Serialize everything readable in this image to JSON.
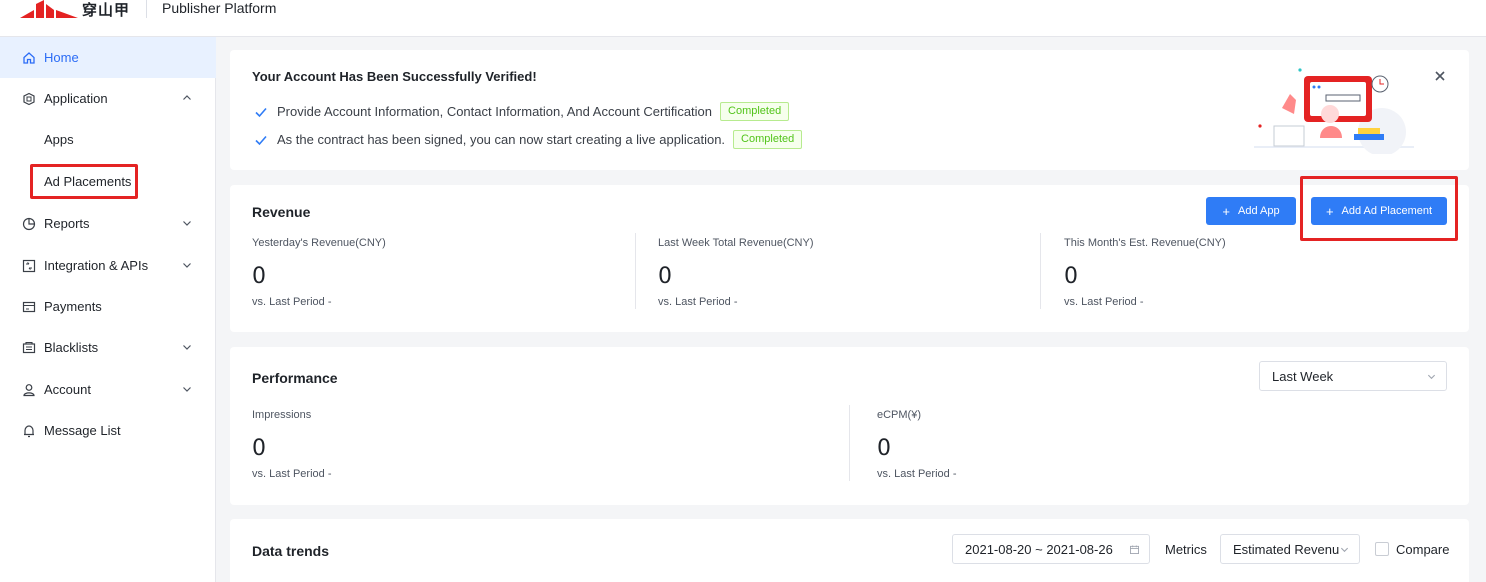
{
  "header": {
    "logo_text": "穿山甲",
    "platform_title": "Publisher Platform"
  },
  "sidebar": {
    "items": [
      {
        "label": "Home",
        "icon": "home-icon",
        "active": true
      },
      {
        "label": "Application",
        "icon": "application-icon",
        "expanded": true
      },
      {
        "label": "Apps",
        "sub": true
      },
      {
        "label": "Ad Placements",
        "sub": true
      },
      {
        "label": "Reports",
        "icon": "reports-icon"
      },
      {
        "label": "Integration & APIs",
        "icon": "integration-icon"
      },
      {
        "label": "Payments",
        "icon": "payments-icon"
      },
      {
        "label": "Blacklists",
        "icon": "blacklists-icon"
      },
      {
        "label": "Account",
        "icon": "account-icon"
      },
      {
        "label": "Message List",
        "icon": "bell-icon"
      }
    ]
  },
  "verification": {
    "title": "Your Account Has Been Successfully Verified!",
    "steps": [
      {
        "text": "Provide Account Information, Contact Information, And Account Certification",
        "status": "Completed"
      },
      {
        "text": "As the contract has been signed, you can now start creating a live application.",
        "status": "Completed"
      }
    ]
  },
  "revenue": {
    "title": "Revenue",
    "add_app_label": "Add App",
    "add_placement_label": "Add Ad Placement",
    "metrics": [
      {
        "label": "Yesterday's Revenue(CNY)",
        "value": "0",
        "sub": "vs. Last Period  -"
      },
      {
        "label": "Last Week Total Revenue(CNY)",
        "value": "0",
        "sub": "vs. Last Period  -"
      },
      {
        "label": "This Month's Est. Revenue(CNY)",
        "value": "0",
        "sub": "vs. Last Period  -"
      }
    ]
  },
  "performance": {
    "title": "Performance",
    "period": "Last Week",
    "metrics": [
      {
        "label": "Impressions",
        "value": "0",
        "sub": "vs. Last Period  -"
      },
      {
        "label": "eCPM(¥)",
        "value": "0",
        "sub": "vs. Last Period  -"
      }
    ]
  },
  "trends": {
    "title": "Data trends",
    "date_range": "2021-08-20 ~ 2021-08-26",
    "metrics_label": "Metrics",
    "metric_selected": "Estimated Revenu",
    "compare_label": "Compare"
  },
  "colors": {
    "primary": "#2f7cf6",
    "highlight_box": "#e42323",
    "completed_tag": "#52c41a"
  }
}
